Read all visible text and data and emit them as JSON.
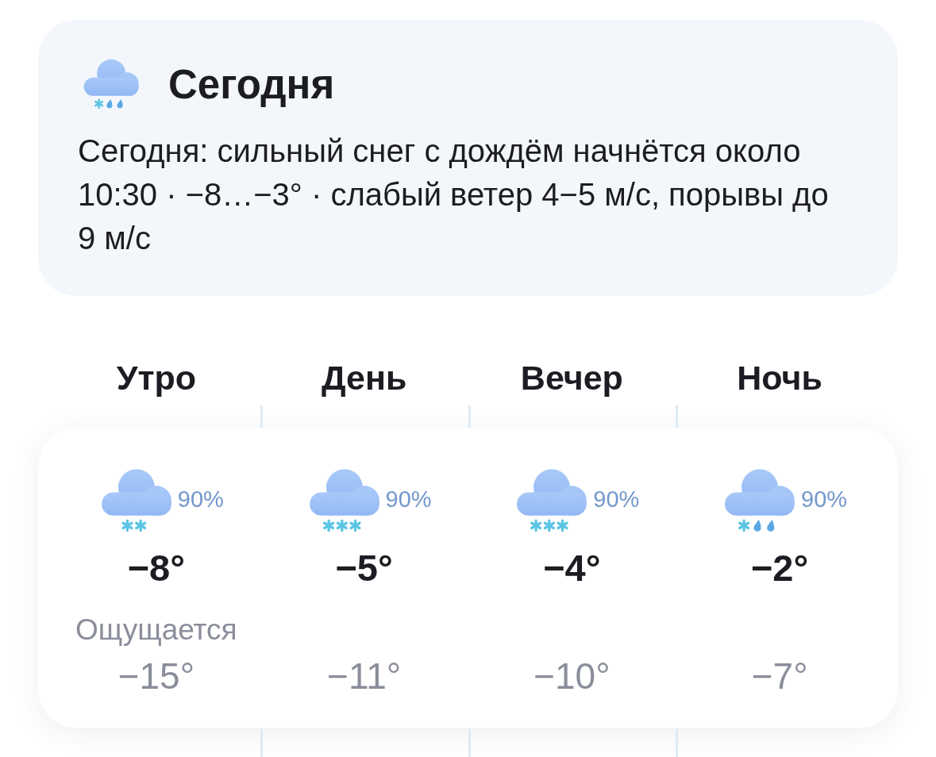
{
  "today": {
    "kind": "sleet",
    "title": "Сегодня",
    "description": "Сегодня: сильный снег с дождём начнётся около 10:30 · −8…−3° · слабый ветер 4−5 м/с, порывы до 9 м/с"
  },
  "periods": [
    {
      "label": "Утро",
      "kind": "snow",
      "precip_chance": "90%",
      "temp": "−8°",
      "feels_label": "Ощущается",
      "feels_temp": "−15°"
    },
    {
      "label": "День",
      "kind": "heavy_snow",
      "precip_chance": "90%",
      "temp": "−5°",
      "feels_temp": "−11°"
    },
    {
      "label": "Вечер",
      "kind": "heavy_snow",
      "precip_chance": "90%",
      "temp": "−4°",
      "feels_temp": "−10°"
    },
    {
      "label": "Ночь",
      "kind": "sleet",
      "precip_chance": "90%",
      "temp": "−2°",
      "feels_temp": "−7°"
    }
  ]
}
